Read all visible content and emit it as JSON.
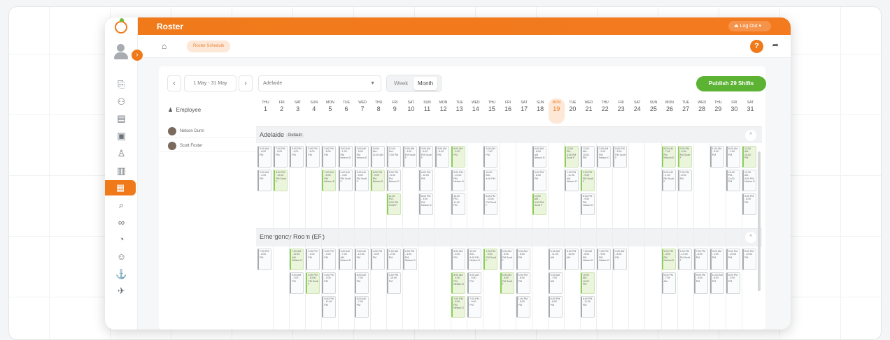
{
  "app": {
    "title": "Roster",
    "logout_label": "Log Out",
    "help": "?"
  },
  "breadcrumb": {
    "current": "Roster Schedule"
  },
  "nav_icons": [
    "report-icon",
    "team-icon",
    "document-icon",
    "briefcase-icon",
    "user-group-icon",
    "clipboard-icon",
    "calendar-icon",
    "search-icon",
    "handshake-icon",
    "chart-icon",
    "person-icon",
    "badge-icon",
    "plane-icon"
  ],
  "toolbar": {
    "prev": "‹",
    "range": "1 May - 31 May",
    "next": "›",
    "location": "Adelaide",
    "view_week": "Week",
    "view_month": "Month",
    "publish": "Publish 29 Shifts"
  },
  "employees": {
    "header": "Employee",
    "list": [
      "Nelson Dunn",
      "Scott Foster"
    ]
  },
  "days": [
    {
      "n": "THU",
      "d": "1"
    },
    {
      "n": "FRI",
      "d": "2"
    },
    {
      "n": "SAT",
      "d": "3"
    },
    {
      "n": "SUN",
      "d": "4"
    },
    {
      "n": "MON",
      "d": "5"
    },
    {
      "n": "TUE",
      "d": "6"
    },
    {
      "n": "WED",
      "d": "7"
    },
    {
      "n": "THU",
      "d": "8"
    },
    {
      "n": "FRI",
      "d": "9"
    },
    {
      "n": "SAT",
      "d": "10"
    },
    {
      "n": "SUN",
      "d": "11"
    },
    {
      "n": "MON",
      "d": "12"
    },
    {
      "n": "TUE",
      "d": "13"
    },
    {
      "n": "WED",
      "d": "14"
    },
    {
      "n": "THU",
      "d": "15"
    },
    {
      "n": "FRI",
      "d": "16"
    },
    {
      "n": "SAT",
      "d": "17"
    },
    {
      "n": "SUN",
      "d": "18"
    },
    {
      "n": "MON",
      "d": "19"
    },
    {
      "n": "TUE",
      "d": "20"
    },
    {
      "n": "WED",
      "d": "21"
    },
    {
      "n": "THU",
      "d": "22"
    },
    {
      "n": "FRI",
      "d": "23"
    },
    {
      "n": "SAT",
      "d": "24"
    },
    {
      "n": "SUN",
      "d": "25"
    },
    {
      "n": "MON",
      "d": "26"
    },
    {
      "n": "TUE",
      "d": "27"
    },
    {
      "n": "WED",
      "d": "28"
    },
    {
      "n": "THU",
      "d": "29"
    },
    {
      "n": "FRI",
      "d": "30"
    },
    {
      "n": "SAT",
      "d": "31"
    }
  ],
  "today_index": 18,
  "groups": [
    {
      "name": "Adelaide",
      "badge": "Default",
      "collapse": "^"
    },
    {
      "name": "Emergency Room (ER)",
      "badge": "",
      "collapse": "^"
    }
  ],
  "shifts_adelaide": [
    {
      "day": 0,
      "row": 0,
      "t": "3:00 AM - 8:00 PM",
      "g": false
    },
    {
      "day": 1,
      "row": 0,
      "t": "7:00 PM - 8:00 PM",
      "g": false
    },
    {
      "day": 2,
      "row": 0,
      "t": "3:00 PM - 4:00 PM",
      "g": false
    },
    {
      "day": 3,
      "row": 0,
      "t": "3:00 PM - 6:00 PM",
      "g": false
    },
    {
      "day": 4,
      "row": 0,
      "t": "3:00 PM - 8:00 PM",
      "g": false
    },
    {
      "day": 5,
      "row": 0,
      "t": "3:00 AM - 1:00 PM Nelson D",
      "g": false
    },
    {
      "day": 6,
      "row": 0,
      "t": "3:00 AM - 5:00 PM Nelson D",
      "g": false
    },
    {
      "day": 7,
      "row": 0,
      "t": "10:00 AM - 11:00 AM",
      "g": false
    },
    {
      "day": 8,
      "row": 0,
      "t": "12:00 AM - 7:00 PM",
      "g": false
    },
    {
      "day": 9,
      "row": 0,
      "t": "3:00 AM - 4:00 PM Scott F",
      "g": false
    },
    {
      "day": 10,
      "row": 0,
      "t": "3:00 AM - 6:00 PM Scott F",
      "g": false
    },
    {
      "day": 11,
      "row": 0,
      "t": "3:00 AM - 8:00 PM",
      "g": false
    },
    {
      "day": 12,
      "row": 0,
      "t": "8:00 AM - 2:00 PM",
      "g": true
    },
    {
      "day": 14,
      "row": 0,
      "t": "3:00 AM - 7:00 PM",
      "g": false
    },
    {
      "day": 17,
      "row": 0,
      "t": "6:00 AM - 8:00 AM Nelson D",
      "g": false
    },
    {
      "day": 19,
      "row": 0,
      "t": "12:00 PM - 3:00 PM Scott F",
      "g": true
    },
    {
      "day": 20,
      "row": 0,
      "t": "12:00 AM - 10:00 PM",
      "g": false
    },
    {
      "day": 21,
      "row": 0,
      "t": "3:00 AM - 2:00 PM Nelson D",
      "g": false
    },
    {
      "day": 22,
      "row": 0,
      "t": "5:00 PM - 3:00 PM Scott F",
      "g": false
    },
    {
      "day": 25,
      "row": 0,
      "t": "8:00 AM - 7:00 PM Nelson D",
      "g": true
    },
    {
      "day": 26,
      "row": 0,
      "t": "3:00 PM - 9:00 PM Scott F",
      "g": true
    },
    {
      "day": 28,
      "row": 0,
      "t": "1:00 AM - 5:00 PM",
      "g": false
    },
    {
      "day": 29,
      "row": 0,
      "t": "6:00 AM - 1:00 PM",
      "g": false
    },
    {
      "day": 30,
      "row": 0,
      "t": "5:00 PM - 6:00 PM",
      "g": false
    },
    {
      "day": 31,
      "row": 0,
      "t": "12:00 AM - 10:00 PM",
      "g": true
    },
    {
      "day": 0,
      "row": 1,
      "t": "3:00 AM - 2:00 PM",
      "g": false
    },
    {
      "day": 1,
      "row": 1,
      "t": "8:00 PM - 12:00 PM Scott F",
      "g": true
    },
    {
      "day": 4,
      "row": 1,
      "t": "7:00 AM - 8:00 PM Nelson D",
      "g": true
    },
    {
      "day": 5,
      "row": 1,
      "t": "4:00 AM - 4:00 PM Scott F",
      "g": false
    },
    {
      "day": 6,
      "row": 1,
      "t": "3:00 AM - 5:00 PM Scott F",
      "g": false
    },
    {
      "day": 7,
      "row": 1,
      "t": "8:00 PM - 9:00 PM Nelson D",
      "g": true
    },
    {
      "day": 8,
      "row": 1,
      "t": "5:00 PM - 6:00 PM Nelson D",
      "g": false
    },
    {
      "day": 10,
      "row": 1,
      "t": "6:00 PM - 11:00 PM",
      "g": false
    },
    {
      "day": 12,
      "row": 1,
      "t": "5:00 PM - 12:00 PM Nelson D",
      "g": false
    },
    {
      "day": 14,
      "row": 1,
      "t": "10:00 AM - 4:00 PM",
      "g": false
    },
    {
      "day": 17,
      "row": 1,
      "t": "5:00 PM - 8:00 PM",
      "g": false
    },
    {
      "day": 19,
      "row": 1,
      "t": "1:00 PM - 11:00 AM Nelson D",
      "g": false
    },
    {
      "day": 20,
      "row": 1,
      "t": "2:00 PM - 9:00 PM Scott F",
      "g": true
    },
    {
      "day": 25,
      "row": 1,
      "t": "5:00 AM - 1:00 PM Scott F",
      "g": false
    },
    {
      "day": 26,
      "row": 1,
      "t": "7:00 PM - 8:00 PM",
      "g": false
    },
    {
      "day": 29,
      "row": 1,
      "t": "10:00 PM - 11:00 PM",
      "g": false
    },
    {
      "day": 30,
      "row": 1,
      "t": "7:00 PM - 11:00 PM",
      "g": false
    },
    {
      "day": 31,
      "row": 1,
      "t": "10:00 AM - 4:00 PM Nelson D",
      "g": false
    },
    {
      "day": 8,
      "row": 2,
      "t": "11:00 PM - 9:00 PM Scott F",
      "g": true
    },
    {
      "day": 10,
      "row": 2,
      "t": "8:00 PM - 3:00 PM Nelson D",
      "g": false
    },
    {
      "day": 12,
      "row": 2,
      "t": "10:00 PM - 11:00 PM",
      "g": false
    },
    {
      "day": 14,
      "row": 2,
      "t": "8:00 PM - 10:00 PM Scott F",
      "g": false
    },
    {
      "day": 17,
      "row": 2,
      "t": "10:00 AM - 5:00 PM Scott F",
      "g": true
    },
    {
      "day": 20,
      "row": 2,
      "t": "8:00 PM - 9:00 PM Nelson D",
      "g": false
    },
    {
      "day": 31,
      "row": 2,
      "t": "3:00 PM - 8:00 PM",
      "g": false
    }
  ],
  "shifts_er": [
    {
      "day": 0,
      "row": 0,
      "t": "7:00 PM - 8:00 PM",
      "g": false
    },
    {
      "day": 2,
      "row": 0,
      "t": "7:00 AM - 11:00 AM Nelson D",
      "g": true
    },
    {
      "day": 3,
      "row": 0,
      "t": "3:00 PM - 1:00 PM",
      "g": false
    },
    {
      "day": 4,
      "row": 0,
      "t": "3:00 PM - 4:00 PM",
      "g": false
    },
    {
      "day": 5,
      "row": 0,
      "t": "3:00 AM - 7:00 AM Nelson D",
      "g": false
    },
    {
      "day": 6,
      "row": 0,
      "t": "3:00 AM - 10:00 PM",
      "g": false
    },
    {
      "day": 7,
      "row": 0,
      "t": "4:00 PM - 5:00 PM",
      "g": false
    },
    {
      "day": 8,
      "row": 0,
      "t": "1:00 AM - 2:00 PM",
      "g": false
    },
    {
      "day": 9,
      "row": 0,
      "t": "2:00 PM - 4:00 PM Nelson D",
      "g": false
    },
    {
      "day": 12,
      "row": 0,
      "t": "6:00 AM - 5:00 PM",
      "g": false
    },
    {
      "day": 13,
      "row": 0,
      "t": "10:00 AM - 9:00 PM Nelson D",
      "g": false
    },
    {
      "day": 14,
      "row": 0,
      "t": "1:00 PM - 9:00 PM Scott F",
      "g": true
    },
    {
      "day": 15,
      "row": 0,
      "t": "3:00 AM - 8:00 PM Scott F",
      "g": false
    },
    {
      "day": 16,
      "row": 0,
      "t": "3:00 AM - 6:00 PM",
      "g": false
    },
    {
      "day": 18,
      "row": 0,
      "t": "6:00 AM - 11:00 AM",
      "g": false
    },
    {
      "day": 19,
      "row": 0,
      "t": "8:00 PM - 10:00 AM",
      "g": false
    },
    {
      "day": 20,
      "row": 0,
      "t": "7:00 AM - 8:00 PM Nelson D",
      "g": false
    },
    {
      "day": 21,
      "row": 0,
      "t": "7:00 PM - 9:00 PM Nelson D",
      "g": false
    },
    {
      "day": 22,
      "row": 0,
      "t": "2:00 AM - 8:00 PM",
      "g": false
    },
    {
      "day": 25,
      "row": 0,
      "t": "3:00 PM - 4:00 PM Nelson D",
      "g": true
    },
    {
      "day": 26,
      "row": 0,
      "t": "1:00 PM - 10:00 PM Scott F",
      "g": false
    },
    {
      "day": 27,
      "row": 0,
      "t": "7:00 PM - 8:00 PM",
      "g": false
    },
    {
      "day": 28,
      "row": 0,
      "t": "3:00 AM - 1:00 PM",
      "g": false
    },
    {
      "day": 29,
      "row": 0,
      "t": "5:00 PM - 10:00 PM",
      "g": false
    },
    {
      "day": 30,
      "row": 0,
      "t": "5:00 PM - 12:00 PM",
      "g": false
    },
    {
      "day": 2,
      "row": 1,
      "t": "5:00 AM - 1:00 PM",
      "g": false
    },
    {
      "day": 3,
      "row": 1,
      "t": "3:00 PM - 10:00 PM Scott F",
      "g": true
    },
    {
      "day": 4,
      "row": 1,
      "t": "2:00 PM - 3:00 PM",
      "g": false
    },
    {
      "day": 6,
      "row": 1,
      "t": "8:00 AM - 7:00 PM",
      "g": false
    },
    {
      "day": 8,
      "row": 1,
      "t": "3:00 PM - 10:00 PM",
      "g": false
    },
    {
      "day": 12,
      "row": 1,
      "t": "8:00 AM - 4:00 PM Nelson D",
      "g": true
    },
    {
      "day": 13,
      "row": 1,
      "t": "5:00 AM - 5:00 PM",
      "g": false
    },
    {
      "day": 15,
      "row": 1,
      "t": "6:00 AM - 6:00 PM Scott F",
      "g": true
    },
    {
      "day": 16,
      "row": 1,
      "t": "5:00 PM - 6:00 PM",
      "g": false
    },
    {
      "day": 18,
      "row": 1,
      "t": "3:00 AM - 7:00 AM",
      "g": false
    },
    {
      "day": 20,
      "row": 1,
      "t": "10:00 AM - 10:00 PM",
      "g": true
    },
    {
      "day": 25,
      "row": 1,
      "t": "5:00 PM - 7:00 AM",
      "g": false
    },
    {
      "day": 27,
      "row": 1,
      "t": "9:00 PM - 4:00 PM",
      "g": false
    },
    {
      "day": 28,
      "row": 1,
      "t": "11:00 AM - 8:00 PM",
      "g": false
    },
    {
      "day": 29,
      "row": 1,
      "t": "6:00 PM - 3:00 PM",
      "g": false
    },
    {
      "day": 4,
      "row": 2,
      "t": "9:00 PM - 11:00 PM",
      "g": false
    },
    {
      "day": 6,
      "row": 2,
      "t": "6:00 AM - 7:00 PM",
      "g": false
    },
    {
      "day": 12,
      "row": 2,
      "t": "7:00 PM - 8:00 PM Nelson D",
      "g": true
    },
    {
      "day": 13,
      "row": 2,
      "t": "7:00 PM - 9:00 PM",
      "g": false
    },
    {
      "day": 16,
      "row": 2,
      "t": "1:00 PM - 5:00 PM",
      "g": false
    },
    {
      "day": 18,
      "row": 2,
      "t": "6:00 PM - 8:00 PM",
      "g": false
    },
    {
      "day": 20,
      "row": 2,
      "t": "6:00 PM - 11:00 PM",
      "g": false
    }
  ],
  "colors": {
    "accent": "#f07a1a",
    "publish": "#5bb233",
    "shift_green": "#eaf5dc"
  }
}
